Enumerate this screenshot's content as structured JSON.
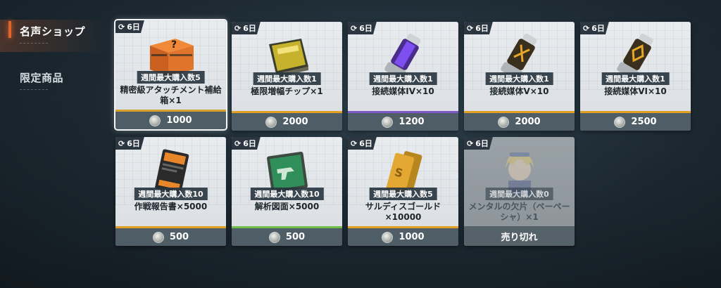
{
  "sidebar": {
    "items": [
      {
        "label": "名声ショップ",
        "active": true
      },
      {
        "label": "限定商品",
        "active": false
      }
    ]
  },
  "refresh_label": "6日",
  "currency_icon": "coin-icon",
  "cards": [
    {
      "limit": "週間最大購入数5",
      "name": "精密級アタッチメント補給箱×1",
      "price": "1000",
      "rarity_color": "#d8a12a",
      "icon": "supply-crate-icon"
    },
    {
      "limit": "週間最大購入数1",
      "name": "極限増幅チップ×1",
      "price": "2000",
      "rarity_color": "#e0a024",
      "icon": "chip-icon"
    },
    {
      "limit": "週間最大購入数1",
      "name": "接続媒体IV×10",
      "price": "1200",
      "rarity_color": "#7f58c8",
      "icon": "purple-capsule-icon"
    },
    {
      "limit": "週間最大購入数1",
      "name": "接続媒体V×10",
      "price": "2000",
      "rarity_color": "#e0a024",
      "icon": "gold-capsule-icon"
    },
    {
      "limit": "週間最大購入数1",
      "name": "接続媒体VI×10",
      "price": "2500",
      "rarity_color": "#e0a024",
      "icon": "gold-capsule-icon"
    },
    {
      "limit": "週間最大購入数10",
      "name": "作戦報告書×5000",
      "price": "500",
      "rarity_color": "#e0a024",
      "icon": "report-icon"
    },
    {
      "limit": "週間最大購入数10",
      "name": "解析図面×5000",
      "price": "500",
      "rarity_color": "#6fbe4b",
      "icon": "blueprint-icon"
    },
    {
      "limit": "週間最大購入数5",
      "name": "サルディスゴールド×10000",
      "price": "1000",
      "rarity_color": "#e0a024",
      "icon": "gold-bar-icon"
    },
    {
      "limit": "週間最大購入数0",
      "name": "メンタルの欠片（ペーペーシャ）×1",
      "sold_out_label": "売り切れ",
      "icon": "doll-portrait-icon"
    }
  ]
}
